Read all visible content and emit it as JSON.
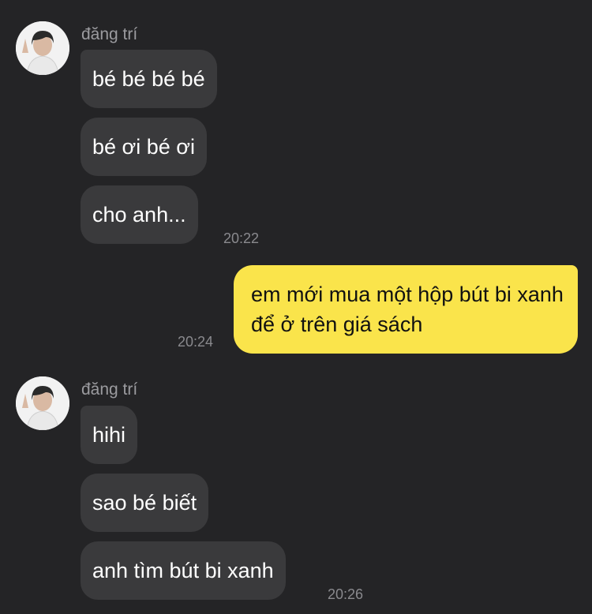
{
  "groups": [
    {
      "sender": "đăng trí",
      "messages": [
        "bé bé bé bé",
        "bé ơi bé ơi",
        "cho anh..."
      ],
      "time": "20:22"
    },
    {
      "sender": "đăng trí",
      "messages": [
        "hihi",
        "sao bé biết",
        "anh tìm bút bi xanh"
      ],
      "time": "20:26"
    }
  ],
  "outgoing": {
    "text": "em mới mua một hộp bút bi xanh để ở trên giá sách",
    "time": "20:24"
  },
  "colors": {
    "background": "#242426",
    "incoming_bubble": "#3a3a3c",
    "outgoing_bubble": "#fae44b"
  },
  "icons": {
    "avatar": "profile-photo-avatar"
  }
}
